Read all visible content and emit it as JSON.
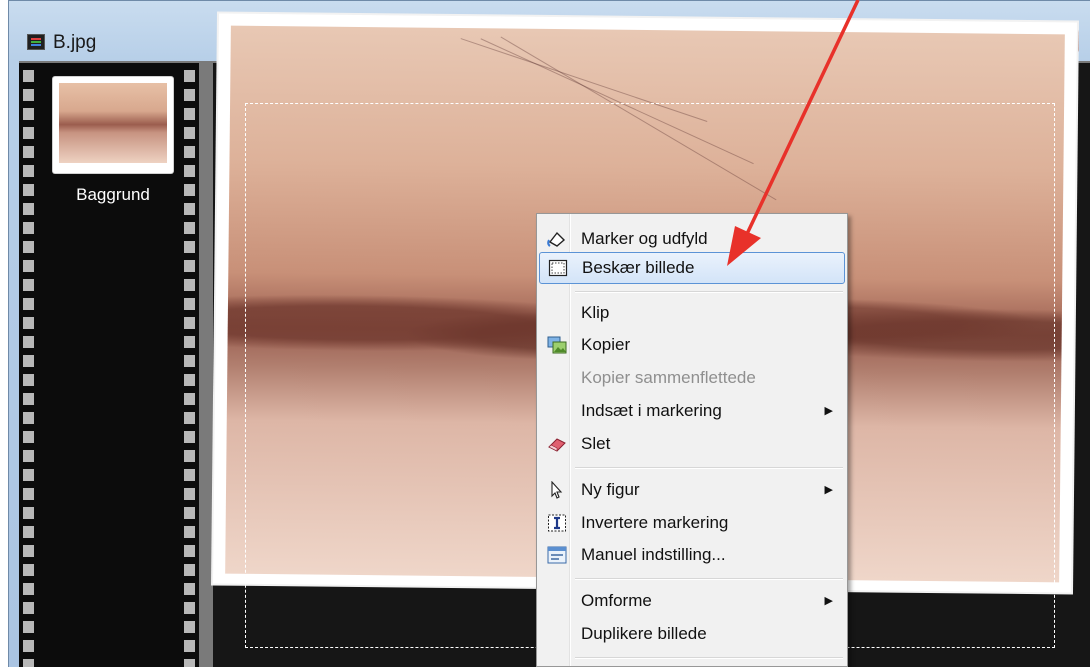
{
  "window": {
    "title": "B.jpg",
    "buttons": {
      "minimize": "minimize",
      "maximize": "maximize",
      "close": "close"
    }
  },
  "layers": [
    {
      "label": "Baggrund"
    }
  ],
  "context_menu": {
    "items": [
      {
        "label": "Marker og udfyld",
        "icon": "select-fill-icon",
        "enabled": true
      },
      {
        "label": "Beskær billede",
        "icon": "crop-icon",
        "enabled": true,
        "highlighted": true
      },
      {
        "label": "Klip",
        "icon": "",
        "enabled": true
      },
      {
        "label": "Kopier",
        "icon": "copy-image-icon",
        "enabled": true
      },
      {
        "label": "Kopier sammenflettede",
        "icon": "",
        "enabled": false
      },
      {
        "label": "Indsæt i markering",
        "icon": "",
        "enabled": true,
        "submenu": true
      },
      {
        "label": "Slet",
        "icon": "eraser-icon",
        "enabled": true
      },
      {
        "label": "Ny figur",
        "icon": "pointer-icon",
        "enabled": true,
        "submenu": true
      },
      {
        "label": "Invertere markering",
        "icon": "invert-selection-icon",
        "enabled": true
      },
      {
        "label": "Manuel indstilling...",
        "icon": "settings-window-icon",
        "enabled": true
      },
      {
        "label": "Omforme",
        "icon": "",
        "enabled": true,
        "submenu": true
      },
      {
        "label": "Duplikere billede",
        "icon": "",
        "enabled": true
      }
    ]
  },
  "colors": {
    "highlight_border": "#5b93d6",
    "annotation_arrow": "#e8312a",
    "close_button": "#c23a1e"
  }
}
